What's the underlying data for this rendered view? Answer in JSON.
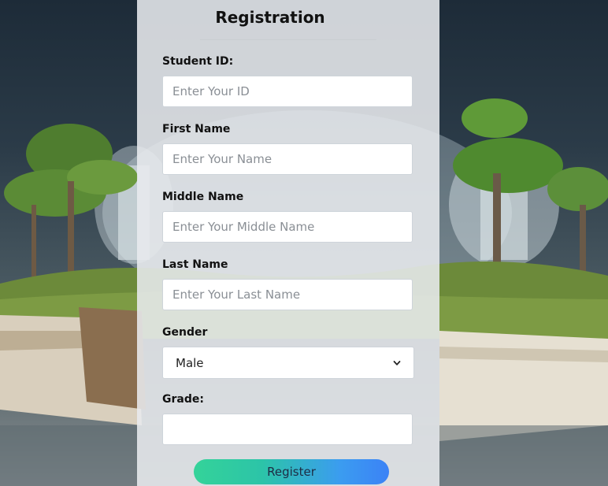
{
  "form": {
    "title": "Registration",
    "fields": {
      "student_id": {
        "label": "Student ID:",
        "placeholder": "Enter Your ID",
        "value": ""
      },
      "first_name": {
        "label": "First Name",
        "placeholder": "Enter Your Name",
        "value": ""
      },
      "middle_name": {
        "label": "Middle Name",
        "placeholder": "Enter Your Middle Name",
        "value": ""
      },
      "last_name": {
        "label": "Last Name",
        "placeholder": "Enter Your Last Name",
        "value": ""
      },
      "gender": {
        "label": "Gender",
        "selected": "Male"
      },
      "grade": {
        "label": "Grade:",
        "value": ""
      }
    },
    "register_label": "Register"
  },
  "colors": {
    "register_gradient_start": "#34d399",
    "register_gradient_end": "#3b82f6",
    "panel_background": "#e8ebee"
  },
  "icons": {
    "gender_dropdown": "chevron-down-icon"
  }
}
